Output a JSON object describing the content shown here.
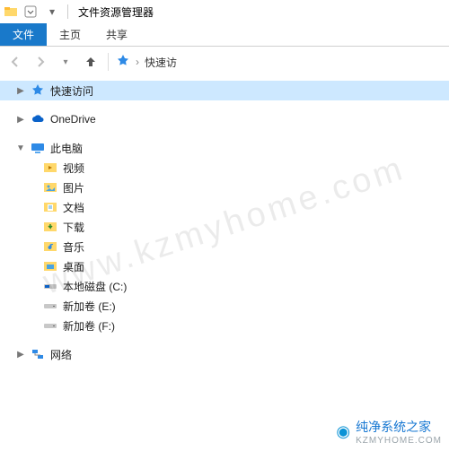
{
  "titlebar": {
    "title": "文件资源管理器"
  },
  "ribbon": {
    "file_label": "文件",
    "tabs": [
      "主页",
      "共享"
    ]
  },
  "nav": {
    "breadcrumb": "快速访"
  },
  "tree": {
    "quick_access": "快速访问",
    "onedrive": "OneDrive",
    "this_pc": "此电脑",
    "children": [
      {
        "label": "视频",
        "icon": "video"
      },
      {
        "label": "图片",
        "icon": "pictures"
      },
      {
        "label": "文档",
        "icon": "documents"
      },
      {
        "label": "下载",
        "icon": "downloads"
      },
      {
        "label": "音乐",
        "icon": "music"
      },
      {
        "label": "桌面",
        "icon": "desktop"
      },
      {
        "label": "本地磁盘 (C:)",
        "icon": "drive-c"
      },
      {
        "label": "新加卷 (E:)",
        "icon": "drive"
      },
      {
        "label": "新加卷 (F:)",
        "icon": "drive"
      }
    ],
    "network": "网络"
  },
  "watermark": {
    "diag": "www.kzmyhome.com",
    "brand": "纯净系统之家",
    "brand_sub": "KZMYHOME.COM"
  }
}
